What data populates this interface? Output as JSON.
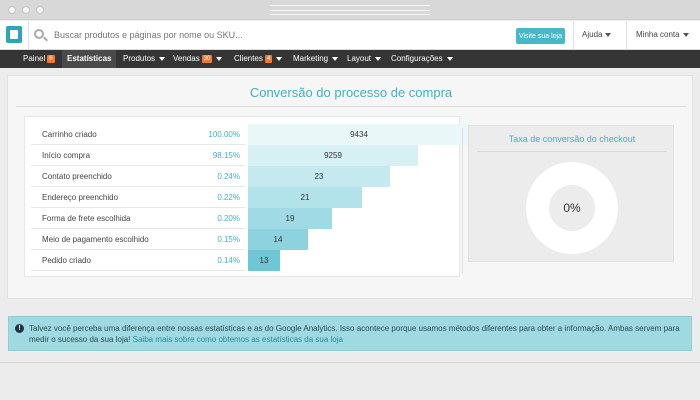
{
  "topbar": {
    "search_placeholder": "Buscar produtos e páginas por nome ou SKU...",
    "visit_store": "Visite sua loja",
    "help": "Ajuda",
    "account": "Minha conta"
  },
  "nav": {
    "items": [
      {
        "label": "Painel",
        "badge": "6"
      },
      {
        "label": "Estatísticas"
      },
      {
        "label": "Produtos"
      },
      {
        "label": "Vendas",
        "badge": "30"
      },
      {
        "label": "Clientes",
        "badge": "4"
      },
      {
        "label": "Marketing"
      },
      {
        "label": "Layout"
      },
      {
        "label": "Configurações"
      }
    ]
  },
  "panel": {
    "title": "Conversão do processo de compra"
  },
  "funnel": {
    "steps": [
      {
        "label": "Carrinho criado",
        "pct": "100.00%",
        "value": "9434",
        "color": "#eaf7f9"
      },
      {
        "label": "Início compra",
        "pct": "98.15%",
        "value": "9259",
        "color": "#d7f0f4"
      },
      {
        "label": "Contato preenchido",
        "pct": "0.24%",
        "value": "23",
        "color": "#c4e9ef"
      },
      {
        "label": "Endereço preenchido",
        "pct": "0.22%",
        "value": "21",
        "color": "#b2e2ea"
      },
      {
        "label": "Forma de frete escolhida",
        "pct": "0.20%",
        "value": "19",
        "color": "#a0dbe5"
      },
      {
        "label": "Meio de pagamento escolhido",
        "pct": "0.15%",
        "value": "14",
        "color": "#8dd3df"
      },
      {
        "label": "Pedido criado",
        "pct": "0.14%",
        "value": "13",
        "color": "#6fc6d5"
      }
    ]
  },
  "rate": {
    "title": "Taxa de conversão do checkout",
    "value": "0%"
  },
  "info": {
    "text": "Talvez você perceba uma diferença entre nossas estatísticas e as do Google Analytics. Isso acontece porque usamos métodos diferentes para obter a informação. Ambas servem para medir o sucesso da sua loja!",
    "link": "Saiba mais sobre como obtemos as estatísticas da sua loja"
  }
}
